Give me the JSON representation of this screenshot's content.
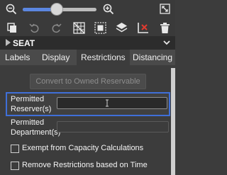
{
  "panel": {
    "title": "SEAT"
  },
  "tabs": [
    {
      "label": "Labels"
    },
    {
      "label": "Display"
    },
    {
      "label": "Restrictions"
    },
    {
      "label": "Distancing"
    }
  ],
  "restrictions": {
    "convert_button_label": "Convert to Owned Reservable",
    "permitted_reservers_label": "Permitted Reserver(s)",
    "permitted_reservers_value": "",
    "permitted_departments_label": "Permitted Department(s)",
    "permitted_departments_value": "",
    "exempt_capacity_label": "Exempt from Capacity Calculations",
    "exempt_capacity_checked": false,
    "remove_restrictions_label": "Remove Restrictions based on Time",
    "remove_restrictions_checked": false
  },
  "zoom": {
    "level": 0.45
  },
  "colors": {
    "accent": "#3f6fd8",
    "toolbar": "#3a3a3a",
    "tab_bar": "#4a4a4a",
    "content": "#3c3c3c",
    "remove_red": "#e03a2f"
  },
  "icons": [
    "zoom-out-icon",
    "zoom-in-icon",
    "expand-icon",
    "copy-icon",
    "undo-icon",
    "redo-icon",
    "grid-select-icon",
    "select-frame-icon",
    "layers-icon",
    "remove-axis-icon",
    "trash-icon",
    "chevron-down-icon",
    "text-cursor-icon"
  ]
}
